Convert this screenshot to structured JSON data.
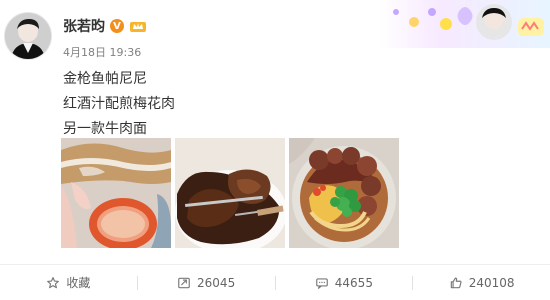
{
  "post": {
    "username": "张若昀",
    "timestamp": "4月18日 19:36",
    "lines": [
      "金枪鱼帕尼尼",
      "红酒汁配煎梅花肉",
      "另一款牛肉面"
    ],
    "badge_v": "V",
    "accent_orange": "#f58f1c"
  },
  "actions": {
    "favorite_label": "收藏",
    "repost_count": "26045",
    "comment_count": "44655",
    "like_count": "240108"
  },
  "icons": {
    "favorite": "star-icon",
    "repost": "share-icon",
    "comment": "comment-icon",
    "like": "thumbs-up-icon"
  }
}
